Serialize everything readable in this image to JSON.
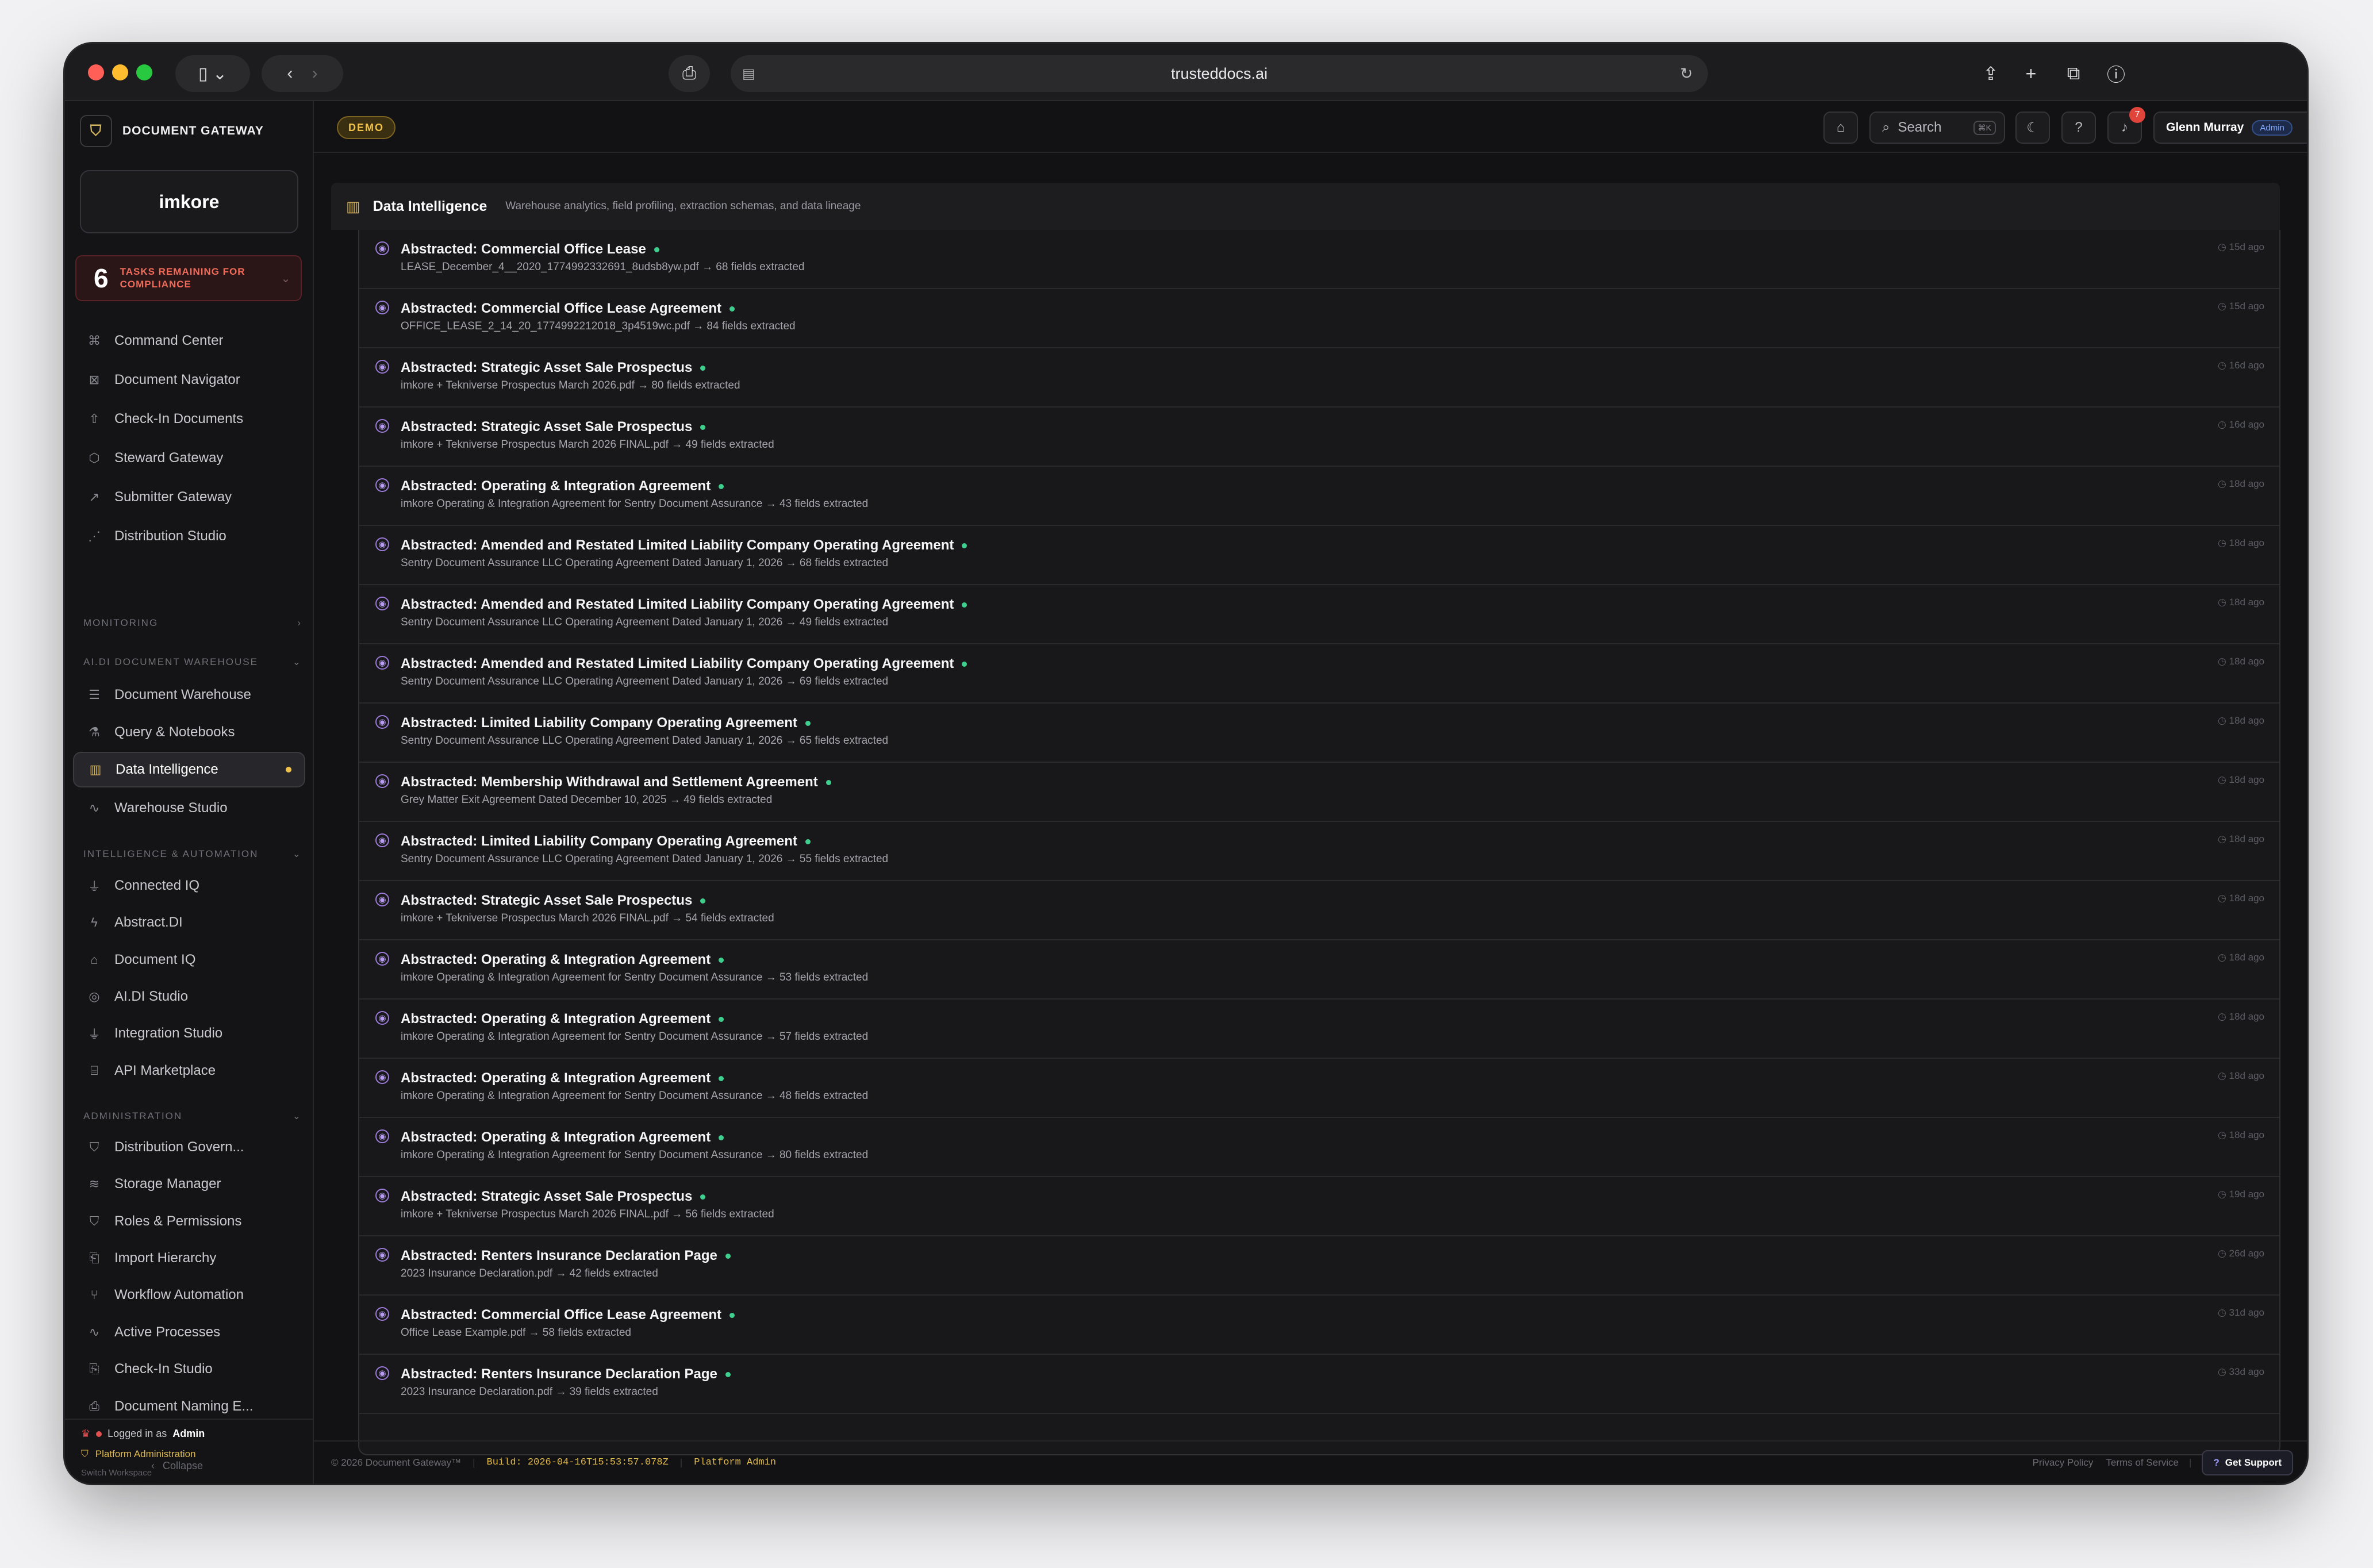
{
  "browser": {
    "url": "trusteddocs.ai"
  },
  "app": {
    "name": "DOCUMENT GATEWAY",
    "logo_text": "imkore",
    "demo_badge": "DEMO"
  },
  "tasks": {
    "count": "6",
    "label": "TASKS REMAINING FOR COMPLIANCE"
  },
  "nav_main": [
    "Command Center",
    "Document Navigator",
    "Check-In Documents",
    "Steward Gateway",
    "Submitter Gateway",
    "Distribution Studio"
  ],
  "sections": {
    "monitoring": "MONITORING",
    "warehouse": "AI.DI DOCUMENT WAREHOUSE",
    "intel": "INTELLIGENCE & AUTOMATION",
    "admin": "ADMINISTRATION"
  },
  "nav_warehouse": [
    "Document Warehouse",
    "Query & Notebooks",
    "Data Intelligence",
    "Warehouse Studio"
  ],
  "nav_intel": [
    "Connected IQ",
    "Abstract.DI",
    "Document IQ",
    "AI.DI Studio",
    "Integration Studio",
    "API Marketplace"
  ],
  "nav_admin": [
    "Distribution Govern...",
    "Storage Manager",
    "Roles & Permissions",
    "Import Hierarchy",
    "Workflow Automation",
    "Active Processes",
    "Check-In Studio",
    "Document Naming E..."
  ],
  "sidebar_footer": {
    "logged_prefix": "Logged in as",
    "logged_user": "Admin",
    "platform": "Platform Administration",
    "switch": "Switch Workspace",
    "collapse": "Collapse"
  },
  "topbar": {
    "search": "Search",
    "search_kbd": "⌘K",
    "notif_count": "7",
    "user": "Glenn Murray",
    "role": "Admin"
  },
  "panel": {
    "title": "Data Intelligence",
    "subtitle": "Warehouse analytics, field profiling, extraction schemas, and data lineage"
  },
  "rows": [
    {
      "title": "Abstracted: Commercial Office Lease",
      "sub": "LEASE_December_4__2020_1774992332691_8udsb8yw.pdf → 68 fields extracted",
      "ago": "15d ago"
    },
    {
      "title": "Abstracted: Commercial Office Lease Agreement",
      "sub": "OFFICE_LEASE_2_14_20_1774992212018_3p4519wc.pdf → 84 fields extracted",
      "ago": "15d ago"
    },
    {
      "title": "Abstracted: Strategic Asset Sale Prospectus",
      "sub": "imkore + Tekniverse Prospectus March 2026.pdf → 80 fields extracted",
      "ago": "16d ago"
    },
    {
      "title": "Abstracted: Strategic Asset Sale Prospectus",
      "sub": "imkore + Tekniverse Prospectus March 2026 FINAL.pdf → 49 fields extracted",
      "ago": "16d ago"
    },
    {
      "title": "Abstracted: Operating & Integration Agreement",
      "sub": "imkore Operating & Integration Agreement for Sentry Document Assurance → 43 fields extracted",
      "ago": "18d ago"
    },
    {
      "title": "Abstracted: Amended and Restated Limited Liability Company Operating Agreement",
      "sub": "Sentry Document Assurance LLC Operating Agreement Dated January 1, 2026 → 68 fields extracted",
      "ago": "18d ago"
    },
    {
      "title": "Abstracted: Amended and Restated Limited Liability Company Operating Agreement",
      "sub": "Sentry Document Assurance LLC Operating Agreement Dated January 1, 2026 → 49 fields extracted",
      "ago": "18d ago"
    },
    {
      "title": "Abstracted: Amended and Restated Limited Liability Company Operating Agreement",
      "sub": "Sentry Document Assurance LLC Operating Agreement Dated January 1, 2026 → 69 fields extracted",
      "ago": "18d ago"
    },
    {
      "title": "Abstracted: Limited Liability Company Operating Agreement",
      "sub": "Sentry Document Assurance LLC Operating Agreement Dated January 1, 2026 → 65 fields extracted",
      "ago": "18d ago"
    },
    {
      "title": "Abstracted: Membership Withdrawal and Settlement Agreement",
      "sub": "Grey Matter Exit Agreement Dated December 10, 2025 → 49 fields extracted",
      "ago": "18d ago"
    },
    {
      "title": "Abstracted: Limited Liability Company Operating Agreement",
      "sub": "Sentry Document Assurance LLC Operating Agreement Dated January 1, 2026 → 55 fields extracted",
      "ago": "18d ago"
    },
    {
      "title": "Abstracted: Strategic Asset Sale Prospectus",
      "sub": "imkore + Tekniverse Prospectus March 2026 FINAL.pdf → 54 fields extracted",
      "ago": "18d ago"
    },
    {
      "title": "Abstracted: Operating & Integration Agreement",
      "sub": "imkore Operating & Integration Agreement for Sentry Document Assurance → 53 fields extracted",
      "ago": "18d ago"
    },
    {
      "title": "Abstracted: Operating & Integration Agreement",
      "sub": "imkore Operating & Integration Agreement for Sentry Document Assurance → 57 fields extracted",
      "ago": "18d ago"
    },
    {
      "title": "Abstracted: Operating & Integration Agreement",
      "sub": "imkore Operating & Integration Agreement for Sentry Document Assurance → 48 fields extracted",
      "ago": "18d ago"
    },
    {
      "title": "Abstracted: Operating & Integration Agreement",
      "sub": "imkore Operating & Integration Agreement for Sentry Document Assurance → 80 fields extracted",
      "ago": "18d ago"
    },
    {
      "title": "Abstracted: Strategic Asset Sale Prospectus",
      "sub": "imkore + Tekniverse Prospectus March 2026 FINAL.pdf → 56 fields extracted",
      "ago": "19d ago"
    },
    {
      "title": "Abstracted: Renters Insurance Declaration Page",
      "sub": "2023 Insurance Declaration.pdf → 42 fields extracted",
      "ago": "26d ago"
    },
    {
      "title": "Abstracted: Commercial Office Lease Agreement",
      "sub": "Office Lease Example.pdf → 58 fields extracted",
      "ago": "31d ago"
    },
    {
      "title": "Abstracted: Renters Insurance Declaration Page",
      "sub": "2023 Insurance Declaration.pdf → 39 fields extracted",
      "ago": "33d ago"
    }
  ],
  "footer": {
    "copyright": "© 2026 Document Gateway™",
    "build": "Build: 2026-04-16T15:53:57.078Z",
    "platform": "Platform Admin",
    "privacy": "Privacy Policy",
    "terms": "Terms of Service",
    "support": "Get Support"
  },
  "colors": {
    "accent": "#f0c24a",
    "danger": "#ef6b5a",
    "status": "#3ecf8e",
    "purple": "#9a7bd8",
    "bg": "#121214"
  }
}
